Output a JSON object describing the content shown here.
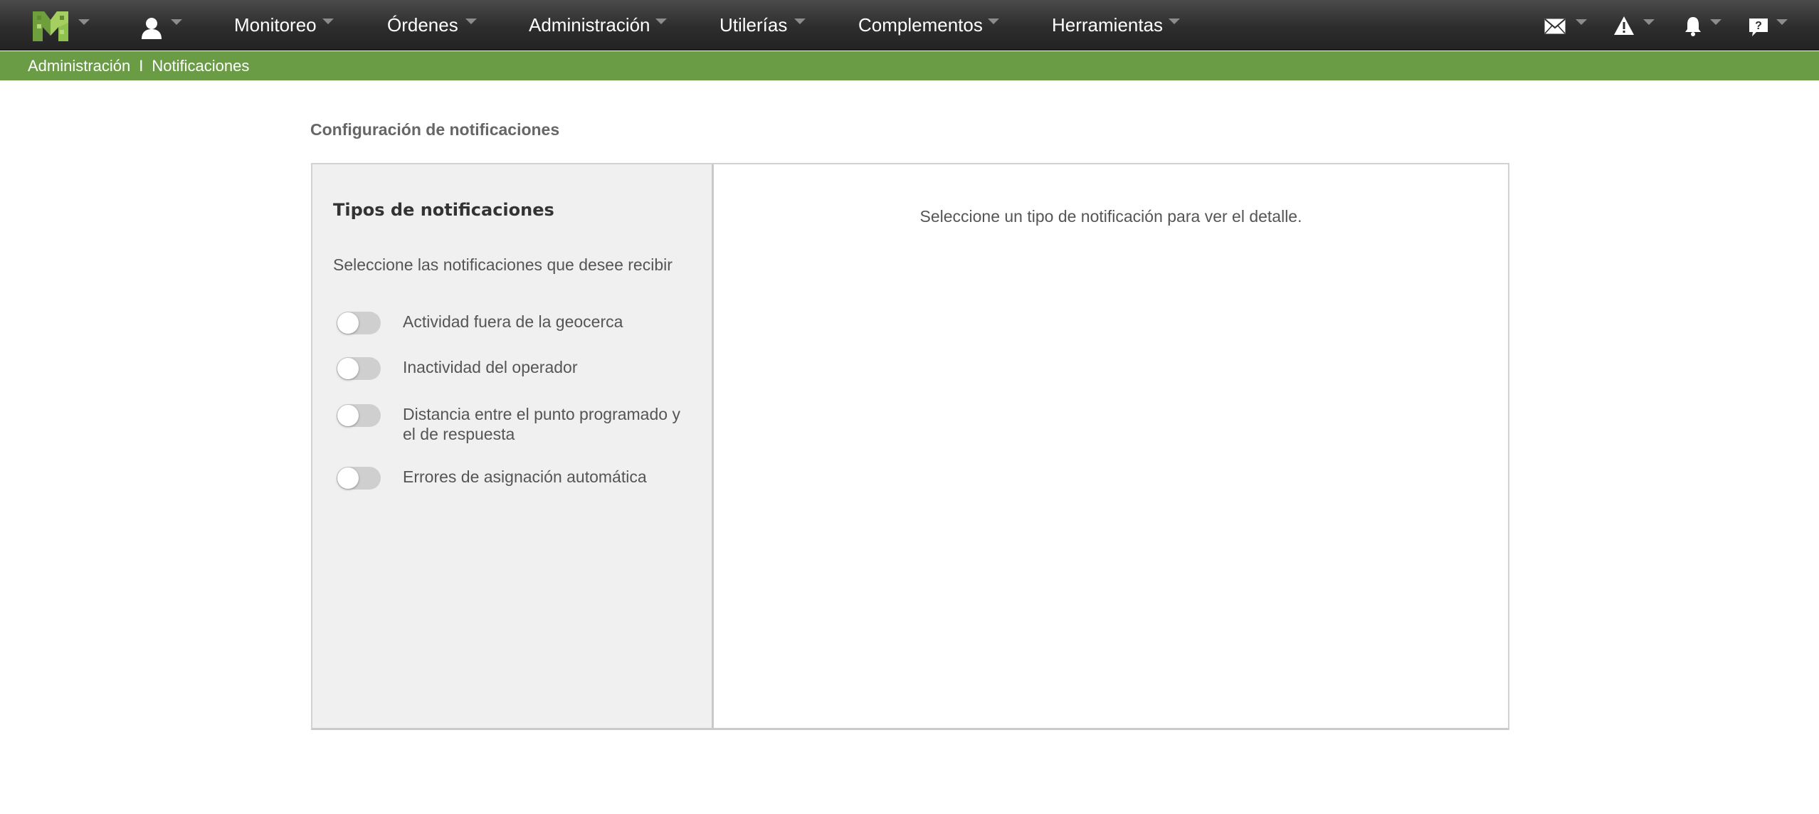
{
  "nav": {
    "menu": [
      {
        "id": "monitoreo",
        "label": "Monitoreo"
      },
      {
        "id": "ordenes",
        "label": "Órdenes"
      },
      {
        "id": "administracion",
        "label": "Administración"
      },
      {
        "id": "utilerias",
        "label": "Utilerías"
      },
      {
        "id": "complementos",
        "label": "Complementos"
      },
      {
        "id": "herramientas",
        "label": "Herramientas"
      }
    ],
    "right_icons": [
      "mail-icon",
      "warning-icon",
      "bell-icon",
      "help-icon"
    ]
  },
  "breadcrumb": {
    "items": [
      "Administración",
      "Notificaciones"
    ],
    "separator": "I"
  },
  "page": {
    "title": "Configuración de notificaciones"
  },
  "notifications": {
    "heading": "Tipos de notificaciones",
    "subtitle": "Seleccione las notificaciones que desee recibir",
    "types": [
      {
        "label": "Actividad fuera de la geocerca",
        "enabled": false
      },
      {
        "label": "Inactividad del operador",
        "enabled": false
      },
      {
        "label": "Distancia entre el punto programado y el de respuesta",
        "enabled": false
      },
      {
        "label": "Errores de asignación automática",
        "enabled": false
      }
    ],
    "detail_placeholder": "Seleccione un tipo de notificación para ver el detalle."
  },
  "colors": {
    "topbar": "#2d2d2d",
    "breadcrumb_bar": "#6a9c46",
    "logo_light": "#8fc14f",
    "logo_dark": "#5f8a36",
    "toggle_off": "#cfcfcf"
  }
}
